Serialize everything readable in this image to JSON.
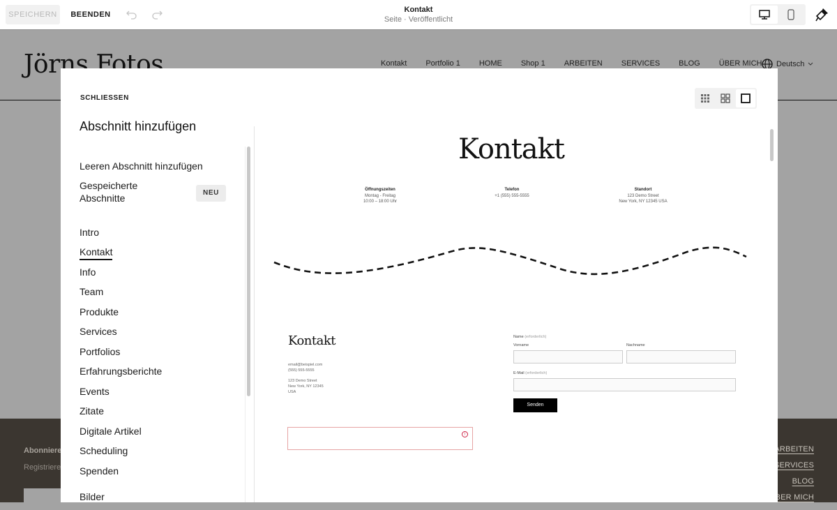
{
  "topbar": {
    "save_label": "SPEICHERN",
    "exit_label": "BEENDEN",
    "page_title": "Kontakt",
    "page_subtitle": "Seite · Veröffentlicht"
  },
  "site": {
    "logo": "Jörns Fotos",
    "nav": [
      "Kontakt",
      "Portfolio 1",
      "HOME",
      "Shop 1",
      "ARBEITEN",
      "SERVICES",
      "BLOG",
      "ÜBER MICH"
    ],
    "language": "Deutsch",
    "footer": {
      "subscribe_title": "Abonnieren",
      "subscribe_text": "Registriere",
      "links": [
        "ARBEITEN",
        "SERVICES",
        "BLOG",
        "ÜBER MICH"
      ]
    }
  },
  "modal": {
    "close_label": "SCHLIESSEN",
    "title": "Abschnitt hinzufügen",
    "blank_section": "Leeren Abschnitt hinzufügen",
    "saved_sections": "Gespeicherte Abschnitte",
    "new_badge": "NEU",
    "categories": [
      "Intro",
      "Kontakt",
      "Info",
      "Team",
      "Produkte",
      "Services",
      "Portfolios",
      "Erfahrungsberichte",
      "Events",
      "Zitate",
      "Digitale Artikel",
      "Scheduling",
      "Spenden",
      "Bilder"
    ],
    "active_category": "Kontakt"
  },
  "preview": {
    "heading": "Kontakt",
    "info": [
      {
        "title": "Öffnungszeiten",
        "lines": [
          "Montag - Freitag",
          "10:00 – 18:00 Uhr"
        ]
      },
      {
        "title": "Telefon",
        "lines": [
          "+1 (555) 555-5555"
        ]
      },
      {
        "title": "Standort",
        "lines": [
          "123 Demo Street",
          "New York, NY 12345 USA"
        ]
      }
    ],
    "second_heading": "Kontakt",
    "contact_lines": [
      "email@beispiel.com",
      "(555) 555-5555",
      "",
      "123 Demo Street",
      "New York, NY 12345",
      "USA"
    ],
    "form": {
      "name_label": "Name",
      "required": "(erforderlich)",
      "first_name": "Vorname",
      "last_name": "Nachname",
      "email_label": "E-Mail",
      "submit": "Senden"
    }
  }
}
